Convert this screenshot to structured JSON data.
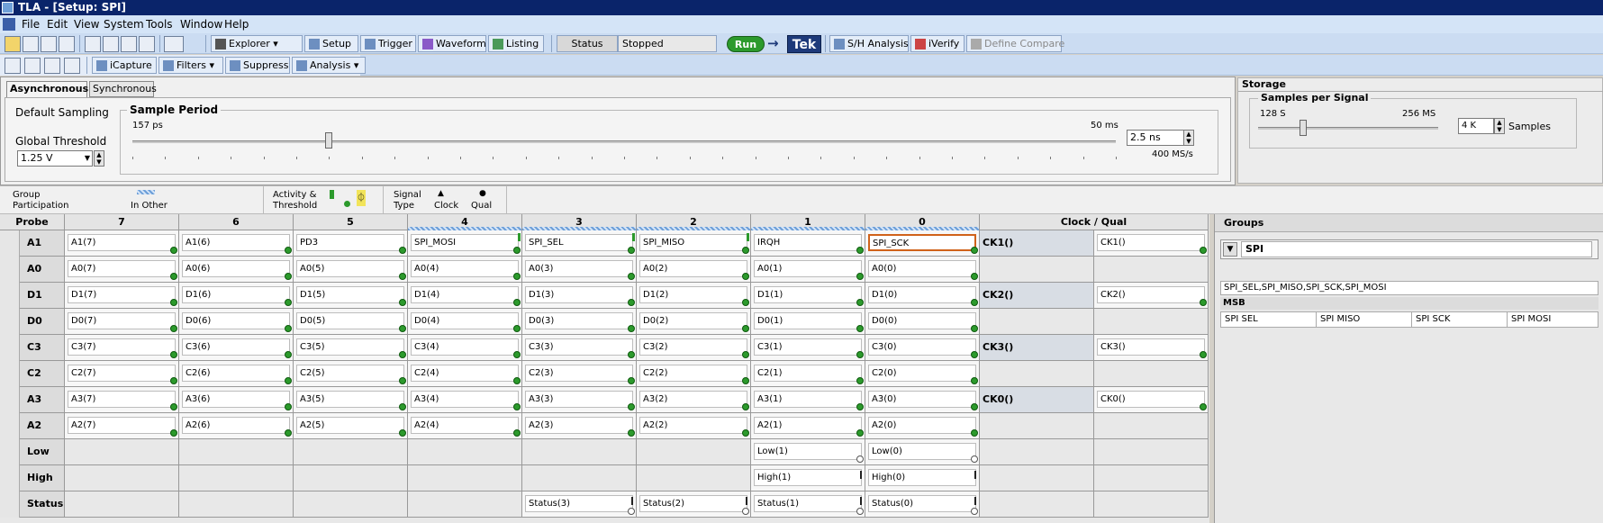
{
  "title": "TLA - [Setup: SPI]",
  "menu": [
    "File",
    "Edit",
    "View",
    "System",
    "Tools",
    "Window",
    "Help"
  ],
  "toolbar1": {
    "explorer": "Explorer",
    "setup": "Setup",
    "trigger": "Trigger",
    "waveform": "Waveform",
    "listing": "Listing",
    "status_label": "Status",
    "status_value": "Stopped",
    "run": "Run",
    "tek": "Tek",
    "sh_analysis": "S/H Analysis",
    "iverify": "iVerify",
    "define_compare": "Define Compare"
  },
  "toolbar2": {
    "icapture": "iCapture",
    "filters": "Filters",
    "suppress": "Suppress",
    "analysis": "Analysis"
  },
  "sampling": {
    "tab_async": "Asynchronous",
    "tab_sync": "Synchronous",
    "default_sampling": "Default Sampling",
    "global_threshold": "Global Threshold",
    "threshold_value": "1.25 V",
    "sample_period": "Sample Period",
    "min": "157 ps",
    "max": "50 ms",
    "period_value": "2.5 ns",
    "rate": "400 MS/s",
    "slider_fraction": 0.2
  },
  "storage": {
    "title": "Storage",
    "samples_per_signal": "Samples per Signal",
    "min": "128 S",
    "max": "256 MS",
    "value": "4 K",
    "unit": "Samples",
    "slider_fraction": 0.25
  },
  "legend": {
    "group_participation": [
      "Group",
      "Participation"
    ],
    "in_other": "In Other",
    "activity": [
      "Activity &",
      "Threshold"
    ],
    "signal_type": [
      "Signal",
      "Type"
    ],
    "clock": "Clock",
    "qual": "Qual"
  },
  "grid": {
    "probe_header": "Probe",
    "clock_qual_header": "Clock / Qual",
    "columns": [
      "7",
      "6",
      "5",
      "4",
      "3",
      "2",
      "1",
      "0"
    ],
    "column_colors": [
      "#c9a6e0",
      "#6d9fd8",
      "#a6d39a",
      "#f2e45a",
      "#f3bd6a",
      "#e46a6a",
      "#c9906a",
      "#9a9a9a"
    ],
    "rows": [
      {
        "name": "A1",
        "cells": [
          "A1(7)",
          "A1(6)",
          "PD3",
          "SPI_MOSI",
          "SPI_SEL",
          "SPI_MISO",
          "IRQH",
          "SPI_SCK"
        ],
        "clk_label": "CK1()",
        "clk_value": "CK1()"
      },
      {
        "name": "A0",
        "cells": [
          "A0(7)",
          "A0(6)",
          "A0(5)",
          "A0(4)",
          "A0(3)",
          "A0(2)",
          "A0(1)",
          "A0(0)"
        ],
        "clk_label": "",
        "clk_value": ""
      },
      {
        "name": "D1",
        "cells": [
          "D1(7)",
          "D1(6)",
          "D1(5)",
          "D1(4)",
          "D1(3)",
          "D1(2)",
          "D1(1)",
          "D1(0)"
        ],
        "clk_label": "CK2()",
        "clk_value": "CK2()"
      },
      {
        "name": "D0",
        "cells": [
          "D0(7)",
          "D0(6)",
          "D0(5)",
          "D0(4)",
          "D0(3)",
          "D0(2)",
          "D0(1)",
          "D0(0)"
        ],
        "clk_label": "",
        "clk_value": ""
      },
      {
        "name": "C3",
        "cells": [
          "C3(7)",
          "C3(6)",
          "C3(5)",
          "C3(4)",
          "C3(3)",
          "C3(2)",
          "C3(1)",
          "C3(0)"
        ],
        "clk_label": "CK3()",
        "clk_value": "CK3()"
      },
      {
        "name": "C2",
        "cells": [
          "C2(7)",
          "C2(6)",
          "C2(5)",
          "C2(4)",
          "C2(3)",
          "C2(2)",
          "C2(1)",
          "C2(0)"
        ],
        "clk_label": "",
        "clk_value": ""
      },
      {
        "name": "A3",
        "cells": [
          "A3(7)",
          "A3(6)",
          "A3(5)",
          "A3(4)",
          "A3(3)",
          "A3(2)",
          "A3(1)",
          "A3(0)"
        ],
        "clk_label": "CK0()",
        "clk_value": "CK0()"
      },
      {
        "name": "A2",
        "cells": [
          "A2(7)",
          "A2(6)",
          "A2(5)",
          "A2(4)",
          "A2(3)",
          "A2(2)",
          "A2(1)",
          "A2(0)"
        ],
        "clk_label": "",
        "clk_value": ""
      },
      {
        "name": "Low",
        "cells": [
          "",
          "",
          "",
          "",
          "",
          "",
          "Low(1)",
          "Low(0)"
        ],
        "clk_label": "",
        "clk_value": ""
      },
      {
        "name": "High",
        "cells": [
          "",
          "",
          "",
          "",
          "",
          "",
          "High(1)",
          "High(0)"
        ],
        "clk_label": "",
        "clk_value": ""
      },
      {
        "name": "Status",
        "cells": [
          "",
          "",
          "",
          "",
          "Status(3)",
          "Status(2)",
          "Status(1)",
          "Status(0)"
        ],
        "clk_label": "",
        "clk_value": ""
      }
    ]
  },
  "groups": {
    "title": "Groups",
    "group_name": "SPI",
    "members": "SPI_SEL,SPI_MISO,SPI_SCK,SPI_MOSI",
    "msb": "MSB",
    "signals": [
      "SPI SEL",
      "SPI MISO",
      "SPI SCK",
      "SPI MOSI"
    ]
  }
}
